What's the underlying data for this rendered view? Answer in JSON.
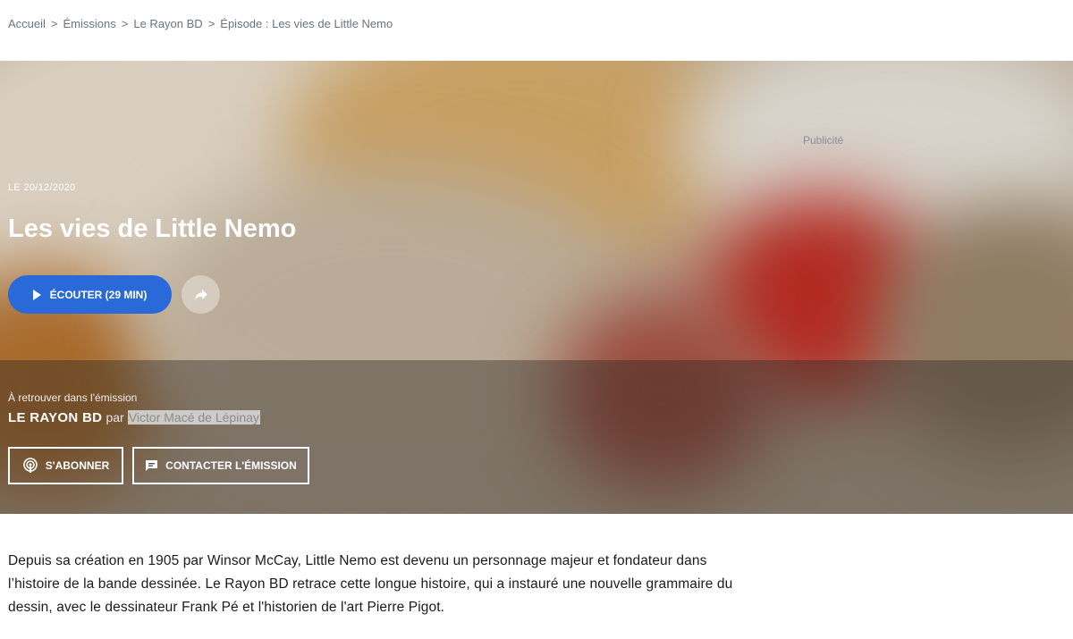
{
  "breadcrumb": {
    "items": [
      "Accueil",
      "Émissions",
      "Le Rayon BD",
      "Épisode : Les vies de Little Nemo"
    ],
    "separator": ">"
  },
  "hero": {
    "publicite": "Publicité",
    "date": "LE 20/12/2020",
    "title": "Les vies de Little Nemo",
    "listen_label": "ÉCOUTER (29 MIN)",
    "retrouver": "À retrouver dans l'émission",
    "show_name": "LE RAYON BD",
    "par": "par",
    "author": "Victor Macé de Lépinay",
    "subscribe_label": "S'ABONNER",
    "contact_label": "CONTACTER L'ÉMISSION"
  },
  "description": "Depuis sa création en 1905 par Winsor McCay, Little Nemo est devenu un personnage majeur et fondateur dans l’histoire de la bande dessinée. Le Rayon BD retrace cette longue histoire, qui a instauré une nouvelle grammaire du dessin, avec le dessinateur Frank Pé et l'historien de l'art Pierre Pigot.",
  "colors": {
    "accent": "#2a6ad8",
    "breadcrumb": "#6b7380"
  },
  "icons": [
    "play-icon",
    "share-icon",
    "podcast-icon",
    "chat-icon"
  ]
}
